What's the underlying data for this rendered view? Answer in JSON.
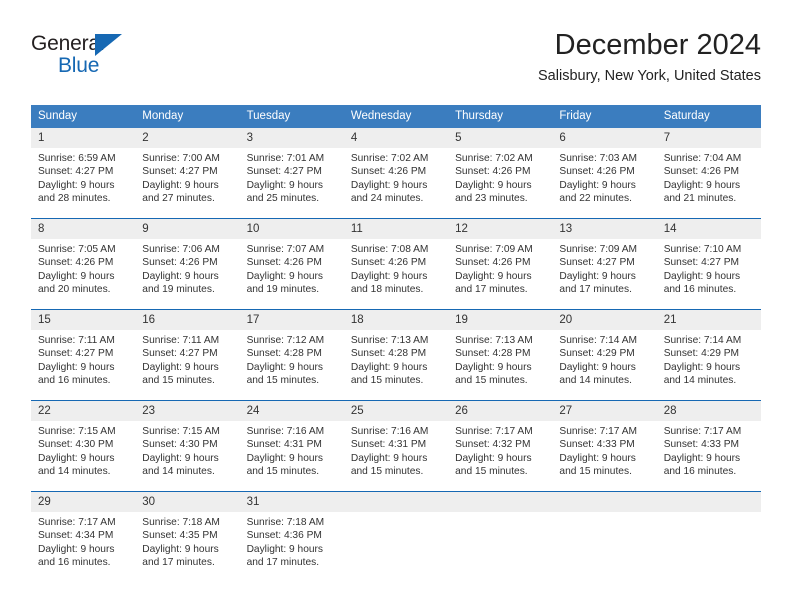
{
  "brand": {
    "name_top": "General",
    "name_bottom": "Blue",
    "triangle_color": "#1668b3",
    "text_color": "#231f20"
  },
  "header": {
    "title": "December 2024",
    "subtitle": "Salisbury, New York, United States"
  },
  "theme": {
    "header_bg": "#3b7dbf",
    "row_divider": "#1668b3",
    "day_band_bg": "#eeeeee",
    "text": "#333333"
  },
  "weekday_headers": [
    "Sunday",
    "Monday",
    "Tuesday",
    "Wednesday",
    "Thursday",
    "Friday",
    "Saturday"
  ],
  "weeks": [
    [
      {
        "day": "1",
        "sunrise": "Sunrise: 6:59 AM",
        "sunset": "Sunset: 4:27 PM",
        "daylight1": "Daylight: 9 hours",
        "daylight2": "and 28 minutes."
      },
      {
        "day": "2",
        "sunrise": "Sunrise: 7:00 AM",
        "sunset": "Sunset: 4:27 PM",
        "daylight1": "Daylight: 9 hours",
        "daylight2": "and 27 minutes."
      },
      {
        "day": "3",
        "sunrise": "Sunrise: 7:01 AM",
        "sunset": "Sunset: 4:27 PM",
        "daylight1": "Daylight: 9 hours",
        "daylight2": "and 25 minutes."
      },
      {
        "day": "4",
        "sunrise": "Sunrise: 7:02 AM",
        "sunset": "Sunset: 4:26 PM",
        "daylight1": "Daylight: 9 hours",
        "daylight2": "and 24 minutes."
      },
      {
        "day": "5",
        "sunrise": "Sunrise: 7:02 AM",
        "sunset": "Sunset: 4:26 PM",
        "daylight1": "Daylight: 9 hours",
        "daylight2": "and 23 minutes."
      },
      {
        "day": "6",
        "sunrise": "Sunrise: 7:03 AM",
        "sunset": "Sunset: 4:26 PM",
        "daylight1": "Daylight: 9 hours",
        "daylight2": "and 22 minutes."
      },
      {
        "day": "7",
        "sunrise": "Sunrise: 7:04 AM",
        "sunset": "Sunset: 4:26 PM",
        "daylight1": "Daylight: 9 hours",
        "daylight2": "and 21 minutes."
      }
    ],
    [
      {
        "day": "8",
        "sunrise": "Sunrise: 7:05 AM",
        "sunset": "Sunset: 4:26 PM",
        "daylight1": "Daylight: 9 hours",
        "daylight2": "and 20 minutes."
      },
      {
        "day": "9",
        "sunrise": "Sunrise: 7:06 AM",
        "sunset": "Sunset: 4:26 PM",
        "daylight1": "Daylight: 9 hours",
        "daylight2": "and 19 minutes."
      },
      {
        "day": "10",
        "sunrise": "Sunrise: 7:07 AM",
        "sunset": "Sunset: 4:26 PM",
        "daylight1": "Daylight: 9 hours",
        "daylight2": "and 19 minutes."
      },
      {
        "day": "11",
        "sunrise": "Sunrise: 7:08 AM",
        "sunset": "Sunset: 4:26 PM",
        "daylight1": "Daylight: 9 hours",
        "daylight2": "and 18 minutes."
      },
      {
        "day": "12",
        "sunrise": "Sunrise: 7:09 AM",
        "sunset": "Sunset: 4:26 PM",
        "daylight1": "Daylight: 9 hours",
        "daylight2": "and 17 minutes."
      },
      {
        "day": "13",
        "sunrise": "Sunrise: 7:09 AM",
        "sunset": "Sunset: 4:27 PM",
        "daylight1": "Daylight: 9 hours",
        "daylight2": "and 17 minutes."
      },
      {
        "day": "14",
        "sunrise": "Sunrise: 7:10 AM",
        "sunset": "Sunset: 4:27 PM",
        "daylight1": "Daylight: 9 hours",
        "daylight2": "and 16 minutes."
      }
    ],
    [
      {
        "day": "15",
        "sunrise": "Sunrise: 7:11 AM",
        "sunset": "Sunset: 4:27 PM",
        "daylight1": "Daylight: 9 hours",
        "daylight2": "and 16 minutes."
      },
      {
        "day": "16",
        "sunrise": "Sunrise: 7:11 AM",
        "sunset": "Sunset: 4:27 PM",
        "daylight1": "Daylight: 9 hours",
        "daylight2": "and 15 minutes."
      },
      {
        "day": "17",
        "sunrise": "Sunrise: 7:12 AM",
        "sunset": "Sunset: 4:28 PM",
        "daylight1": "Daylight: 9 hours",
        "daylight2": "and 15 minutes."
      },
      {
        "day": "18",
        "sunrise": "Sunrise: 7:13 AM",
        "sunset": "Sunset: 4:28 PM",
        "daylight1": "Daylight: 9 hours",
        "daylight2": "and 15 minutes."
      },
      {
        "day": "19",
        "sunrise": "Sunrise: 7:13 AM",
        "sunset": "Sunset: 4:28 PM",
        "daylight1": "Daylight: 9 hours",
        "daylight2": "and 15 minutes."
      },
      {
        "day": "20",
        "sunrise": "Sunrise: 7:14 AM",
        "sunset": "Sunset: 4:29 PM",
        "daylight1": "Daylight: 9 hours",
        "daylight2": "and 14 minutes."
      },
      {
        "day": "21",
        "sunrise": "Sunrise: 7:14 AM",
        "sunset": "Sunset: 4:29 PM",
        "daylight1": "Daylight: 9 hours",
        "daylight2": "and 14 minutes."
      }
    ],
    [
      {
        "day": "22",
        "sunrise": "Sunrise: 7:15 AM",
        "sunset": "Sunset: 4:30 PM",
        "daylight1": "Daylight: 9 hours",
        "daylight2": "and 14 minutes."
      },
      {
        "day": "23",
        "sunrise": "Sunrise: 7:15 AM",
        "sunset": "Sunset: 4:30 PM",
        "daylight1": "Daylight: 9 hours",
        "daylight2": "and 14 minutes."
      },
      {
        "day": "24",
        "sunrise": "Sunrise: 7:16 AM",
        "sunset": "Sunset: 4:31 PM",
        "daylight1": "Daylight: 9 hours",
        "daylight2": "and 15 minutes."
      },
      {
        "day": "25",
        "sunrise": "Sunrise: 7:16 AM",
        "sunset": "Sunset: 4:31 PM",
        "daylight1": "Daylight: 9 hours",
        "daylight2": "and 15 minutes."
      },
      {
        "day": "26",
        "sunrise": "Sunrise: 7:17 AM",
        "sunset": "Sunset: 4:32 PM",
        "daylight1": "Daylight: 9 hours",
        "daylight2": "and 15 minutes."
      },
      {
        "day": "27",
        "sunrise": "Sunrise: 7:17 AM",
        "sunset": "Sunset: 4:33 PM",
        "daylight1": "Daylight: 9 hours",
        "daylight2": "and 15 minutes."
      },
      {
        "day": "28",
        "sunrise": "Sunrise: 7:17 AM",
        "sunset": "Sunset: 4:33 PM",
        "daylight1": "Daylight: 9 hours",
        "daylight2": "and 16 minutes."
      }
    ],
    [
      {
        "day": "29",
        "sunrise": "Sunrise: 7:17 AM",
        "sunset": "Sunset: 4:34 PM",
        "daylight1": "Daylight: 9 hours",
        "daylight2": "and 16 minutes."
      },
      {
        "day": "30",
        "sunrise": "Sunrise: 7:18 AM",
        "sunset": "Sunset: 4:35 PM",
        "daylight1": "Daylight: 9 hours",
        "daylight2": "and 17 minutes."
      },
      {
        "day": "31",
        "sunrise": "Sunrise: 7:18 AM",
        "sunset": "Sunset: 4:36 PM",
        "daylight1": "Daylight: 9 hours",
        "daylight2": "and 17 minutes."
      },
      {
        "day": "",
        "sunrise": "",
        "sunset": "",
        "daylight1": "",
        "daylight2": ""
      },
      {
        "day": "",
        "sunrise": "",
        "sunset": "",
        "daylight1": "",
        "daylight2": ""
      },
      {
        "day": "",
        "sunrise": "",
        "sunset": "",
        "daylight1": "",
        "daylight2": ""
      },
      {
        "day": "",
        "sunrise": "",
        "sunset": "",
        "daylight1": "",
        "daylight2": ""
      }
    ]
  ]
}
